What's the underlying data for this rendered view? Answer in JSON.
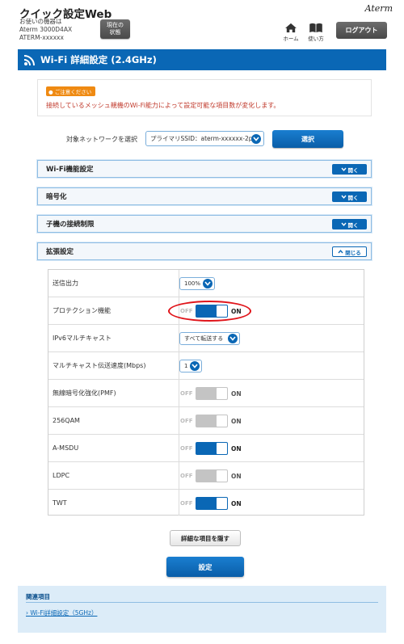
{
  "header": {
    "app_title": "クイック設定Web",
    "device_info_line1": "お使いの機器は",
    "device_info_line2": "Aterm 3000D4AX",
    "device_info_line3": "ATERM-xxxxxx",
    "status_button_line1": "現在の",
    "status_button_line2": "状態",
    "logo": "Aterm",
    "home_label": "ホーム",
    "help_label": "使い方",
    "logout_label": "ログアウト"
  },
  "page_title": "Wi-Fi 詳細設定 (2.4GHz)",
  "notice": {
    "badge": "ご注意ください",
    "text": "接続しているメッシュ親機のWi-Fi能力によって設定可能な項目数が変化します。"
  },
  "network_select": {
    "label": "対象ネットワークを選択",
    "value": "プライマリSSID：aterm-xxxxxx-2p",
    "button_label": "選択"
  },
  "sections": [
    {
      "title": "Wi-Fi機能設定",
      "button": "開く"
    },
    {
      "title": "暗号化",
      "button": "開く"
    },
    {
      "title": "子機の接続制限",
      "button": "開く"
    },
    {
      "title": "拡張設定",
      "button": "閉じる"
    }
  ],
  "toggle_labels": {
    "off": "OFF",
    "on": "ON"
  },
  "settings": [
    {
      "label": "送信出力",
      "type": "select",
      "value": "100%"
    },
    {
      "label": "プロテクション機能",
      "type": "toggle",
      "state": "on"
    },
    {
      "label": "IPv6マルチキャスト",
      "type": "select",
      "value": "すべて転送する"
    },
    {
      "label": "マルチキャスト伝送速度(Mbps)",
      "type": "select",
      "value": "1"
    },
    {
      "label": "無線暗号化強化(PMF)",
      "type": "toggle",
      "state": "off"
    },
    {
      "label": "256QAM",
      "type": "toggle",
      "state": "off"
    },
    {
      "label": "A-MSDU",
      "type": "toggle",
      "state": "on"
    },
    {
      "label": "LDPC",
      "type": "toggle",
      "state": "off"
    },
    {
      "label": "TWT",
      "type": "toggle",
      "state": "on"
    }
  ],
  "hide_button_label": "詳細な項目を隠す",
  "save_button_label": "設定",
  "related": {
    "title": "関連項目",
    "link": "Wi-Fi詳細設定（5GHz）"
  },
  "colors": {
    "primary": "#0a67b5",
    "highlight": "#e0141a",
    "notice_badge": "#ef8a12",
    "notice_text": "#c0392b"
  }
}
